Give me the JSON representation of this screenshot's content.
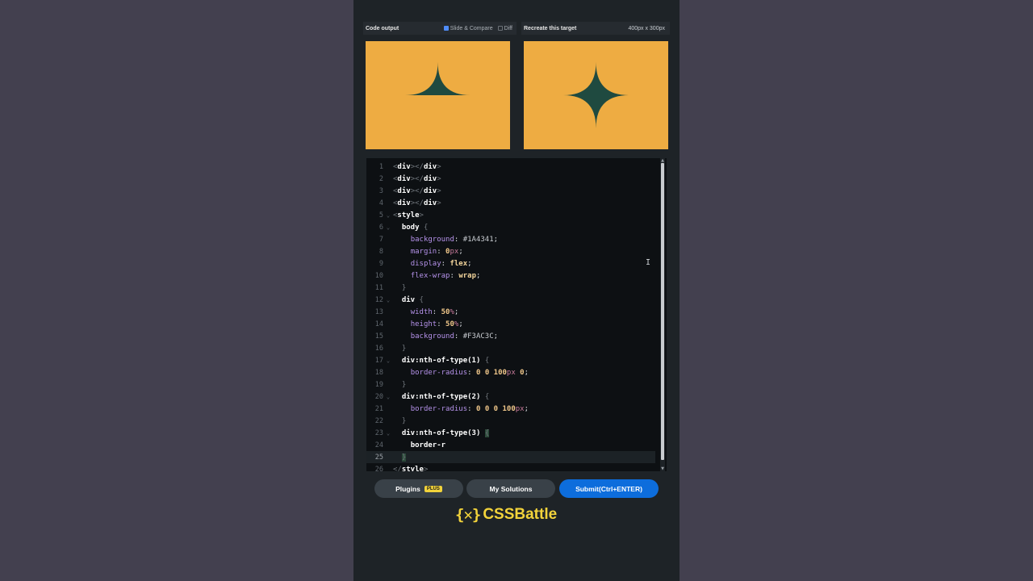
{
  "colors": {
    "page_bg": "#43404f",
    "panel_bg": "#1e2327",
    "target_bg": "#EEAC42",
    "shape_fill": "#1f4a40",
    "submit_bg": "#0d6ddc",
    "brand": "#f2d33b"
  },
  "preview": {
    "code_output_title": "Code output",
    "slide_compare_label": "Slide & Compare",
    "diff_label": "Diff",
    "target_title": "Recreate this target",
    "target_dims": "400px x 300px"
  },
  "editor": {
    "lines": [
      {
        "n": "1",
        "fold": ""
      },
      {
        "n": "2",
        "fold": ""
      },
      {
        "n": "3",
        "fold": ""
      },
      {
        "n": "4",
        "fold": ""
      },
      {
        "n": "5",
        "fold": "⌄"
      },
      {
        "n": "6",
        "fold": "⌄"
      },
      {
        "n": "7",
        "fold": ""
      },
      {
        "n": "8",
        "fold": ""
      },
      {
        "n": "9",
        "fold": ""
      },
      {
        "n": "10",
        "fold": ""
      },
      {
        "n": "11",
        "fold": ""
      },
      {
        "n": "12",
        "fold": "⌄"
      },
      {
        "n": "13",
        "fold": ""
      },
      {
        "n": "14",
        "fold": ""
      },
      {
        "n": "15",
        "fold": ""
      },
      {
        "n": "16",
        "fold": ""
      },
      {
        "n": "17",
        "fold": "⌄"
      },
      {
        "n": "18",
        "fold": ""
      },
      {
        "n": "19",
        "fold": ""
      },
      {
        "n": "20",
        "fold": "⌄"
      },
      {
        "n": "21",
        "fold": ""
      },
      {
        "n": "22",
        "fold": ""
      },
      {
        "n": "23",
        "fold": "⌄"
      },
      {
        "n": "24",
        "fold": ""
      },
      {
        "n": "25",
        "fold": ""
      },
      {
        "n": "26",
        "fold": ""
      }
    ],
    "code": {
      "div_tag": "div",
      "style_tag": "style",
      "body_sel": "body",
      "div_sel": "div",
      "nth1_sel": "div:nth-of-type(1)",
      "nth2_sel": "div:nth-of-type(2)",
      "nth3_sel": "div:nth-of-type(3)",
      "p_background": "background",
      "p_margin": "margin",
      "p_display": "display",
      "p_flexwrap": "flex-wrap",
      "p_width": "width",
      "p_height": "height",
      "p_radius": "border-radius",
      "v_bg1": "#1A4341",
      "v_margin_num": "0",
      "v_margin_unit": "px",
      "v_display": "flex",
      "v_wrap": "wrap",
      "v_width_num": "50",
      "v_height_num": "50",
      "v_pct": "%",
      "v_bg2": "#F3AC3C",
      "v_r1": "0 0 100",
      "v_r1_unit": "px",
      "v_r1_end": " 0",
      "v_r2": "0 0 0 100",
      "v_r2_unit": "px",
      "partial": "border-r"
    }
  },
  "buttons": {
    "plugins": "Plugins",
    "plus_badge": "PLUS",
    "my_solutions": "My Solutions",
    "submit": "Submit(Ctrl+ENTER)"
  },
  "brand": {
    "logo": "{✕}",
    "name": "CSSBattle"
  }
}
